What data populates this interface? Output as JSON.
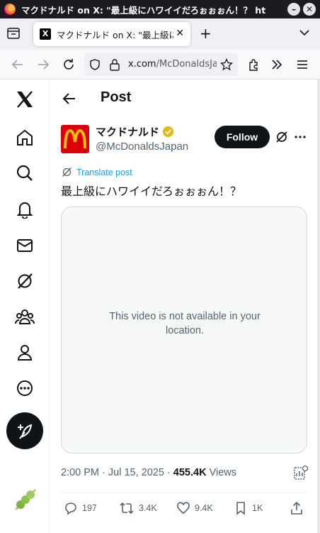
{
  "browser": {
    "window_title": "マクドナルド on X: \"最上級にハワイイだろぉぉぉん！？ https:",
    "tab_title": "マクドナルド on X: \"最上級にハワイイだろぉぉぉん！？",
    "tab_close": "✕",
    "new_tab": "+",
    "url_host": "x.com",
    "url_path": "/McDonaldsJapan"
  },
  "header": {
    "title": "Post"
  },
  "post": {
    "display_name": "マクドナルド",
    "handle": "@McDonaldsJapan",
    "follow_label": "Follow",
    "translate_label": "Translate post",
    "text": "最上級にハワイイだろぉぉぉん！？",
    "video_message": "This video is not available in your location.",
    "time": "2:00 PM · Jul 15, 2025 · ",
    "views_count": "455.4K",
    "views_label": " Views",
    "replies": "197",
    "reposts": "3.4K",
    "likes": "9.4K",
    "bookmarks": "1K"
  },
  "colors": {
    "accent": "#1d9bf0",
    "mcd_red": "#db0007",
    "mcd_yellow": "#ffbc0d",
    "text_primary": "#0f1419",
    "text_secondary": "#536471"
  }
}
